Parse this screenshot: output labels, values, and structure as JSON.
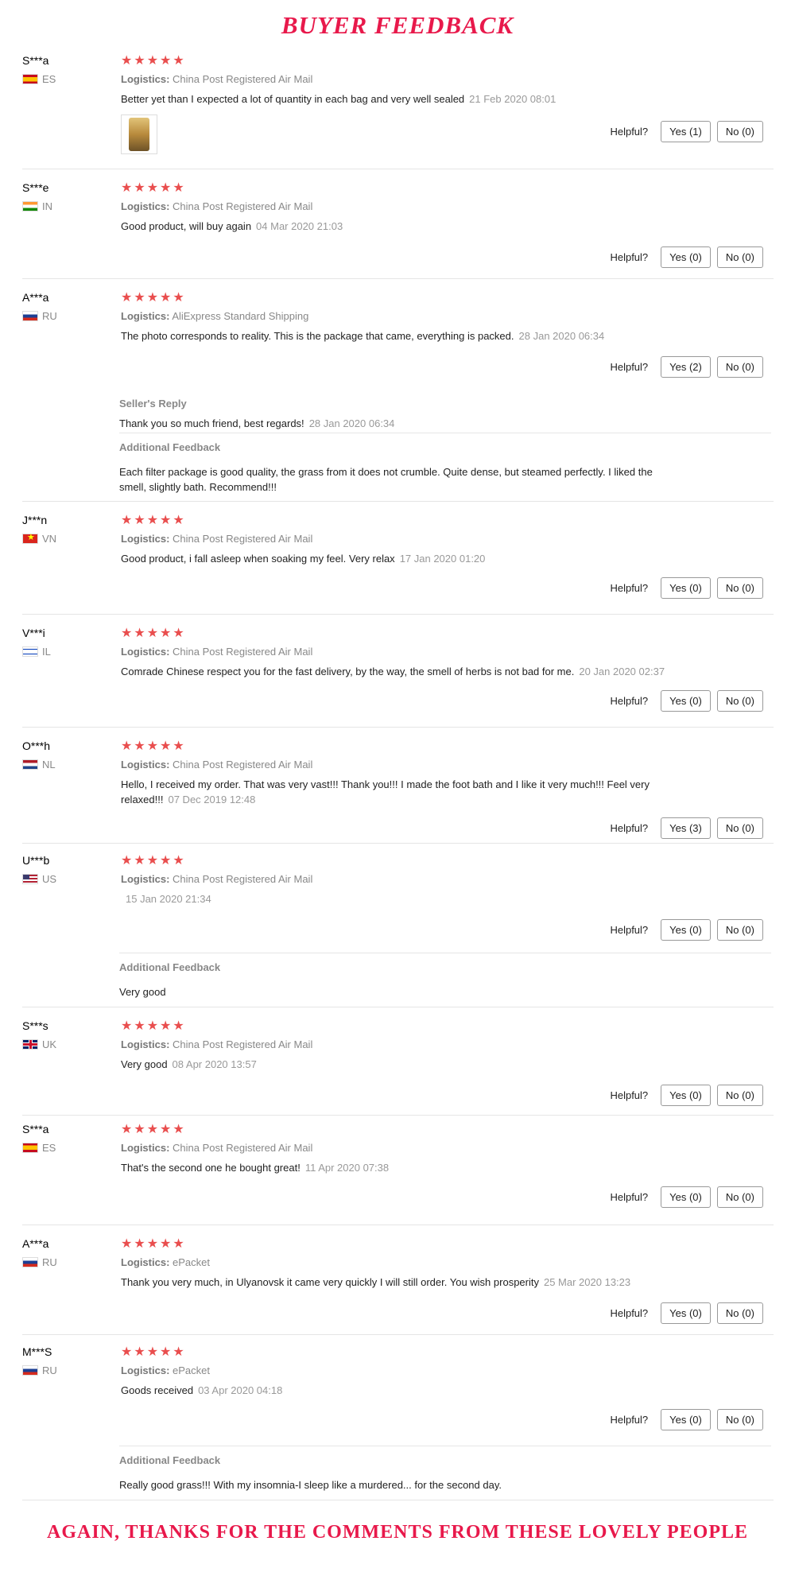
{
  "header": {
    "title": "BUYER FEEDBACK"
  },
  "footer": {
    "text": "AGAIN, THANKS FOR THE COMMENTS FROM THESE LOVELY PEOPLE"
  },
  "labels": {
    "logistics": "Logistics:",
    "helpful": "Helpful?",
    "sellers_reply": "Seller's Reply",
    "additional_feedback": "Additional Feedback",
    "stars": "★★★★★"
  },
  "reviews": [
    {
      "user": "S***a",
      "country": "ES",
      "rating": 5,
      "logistics": "China Post Registered Air Mail",
      "comment": "Better yet than I expected a lot of quantity in each bag and very well sealed",
      "date": "21 Feb 2020 08:01",
      "yes": "Yes (1)",
      "no": "No (0)"
    },
    {
      "user": "S***e",
      "country": "IN",
      "rating": 5,
      "logistics": "China Post Registered Air Mail",
      "comment": "Good product, will buy again",
      "date": "04 Mar 2020 21:03",
      "yes": "Yes (0)",
      "no": "No (0)"
    },
    {
      "user": "A***a",
      "country": "RU",
      "rating": 5,
      "logistics": "AliExpress Standard Shipping",
      "comment": "The photo corresponds to reality. This is the package that came, everything is packed.",
      "date": "28 Jan 2020 06:34",
      "yes": "Yes (2)",
      "no": "No (0)",
      "reply": "Thank you so much friend, best regards!",
      "reply_date": "28 Jan 2020 06:34",
      "additional": "Each filter package is good quality, the grass from it does not crumble. Quite dense, but steamed perfectly. I liked the smell, slightly bath. Recommend!!!"
    },
    {
      "user": "J***n",
      "country": "VN",
      "rating": 5,
      "logistics": "China Post Registered Air Mail",
      "comment": "Good product, i fall asleep when soaking my feel. Very relax",
      "date": "17 Jan 2020 01:20",
      "yes": "Yes (0)",
      "no": "No (0)"
    },
    {
      "user": "V***i",
      "country": "IL",
      "rating": 5,
      "logistics": "China Post Registered Air Mail",
      "comment": "Comrade Chinese respect you for the fast delivery, by the way, the smell of herbs is not bad for me.",
      "date": "20 Jan 2020 02:37",
      "yes": "Yes (0)",
      "no": "No (0)"
    },
    {
      "user": "O***h",
      "country": "NL",
      "rating": 5,
      "logistics": "China Post Registered Air Mail",
      "comment": "Hello, I received my order. That was very vast!!! Thank you!!! I made the foot bath and I like it very much!!! Feel very relaxed!!!",
      "date": "07 Dec 2019 12:48",
      "yes": "Yes (3)",
      "no": "No (0)"
    },
    {
      "user": "U***b",
      "country": "US",
      "rating": 5,
      "logistics": "China Post Registered Air Mail",
      "comment": "",
      "date": "15 Jan 2020 21:34",
      "yes": "Yes (0)",
      "no": "No (0)",
      "additional": "Very good"
    },
    {
      "user": "S***s",
      "country": "UK",
      "rating": 5,
      "logistics": "China Post Registered Air Mail",
      "comment": "Very good",
      "date": "08 Apr 2020 13:57",
      "yes": "Yes (0)",
      "no": "No (0)"
    },
    {
      "user": "S***a",
      "country": "ES",
      "rating": 5,
      "logistics": "China Post Registered Air Mail",
      "comment": "That's the second one he bought great!",
      "date": "11 Apr 2020 07:38",
      "yes": "Yes (0)",
      "no": "No (0)"
    },
    {
      "user": "A***a",
      "country": "RU",
      "rating": 5,
      "logistics": "ePacket",
      "comment": "Thank you very much, in Ulyanovsk it came very quickly I will still order. You wish prosperity",
      "date": "25 Mar 2020 13:23",
      "yes": "Yes (0)",
      "no": "No (0)"
    },
    {
      "user": "M***S",
      "country": "RU",
      "rating": 5,
      "logistics": "ePacket",
      "comment": "Goods received",
      "date": "03 Apr 2020 04:18",
      "yes": "Yes (0)",
      "no": "No (0)",
      "additional": "Really good grass!!! With my insomnia-I sleep like a murdered... for the second day."
    }
  ]
}
